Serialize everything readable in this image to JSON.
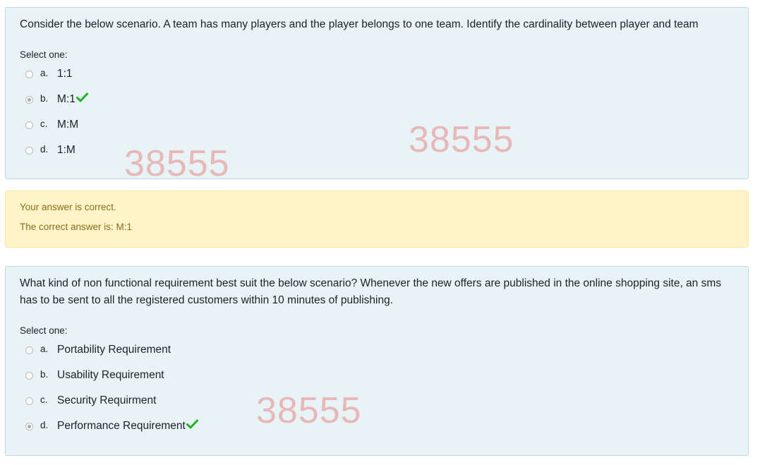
{
  "questions": [
    {
      "text": "Consider the below scenario. A team has many players and the player belongs to one team. Identify the  cardinality between player and team",
      "prompt": "Select one:",
      "options": [
        {
          "letter": "a.",
          "text": "1:1",
          "selected": false
        },
        {
          "letter": "b.",
          "text": "M:1",
          "selected": true,
          "correct": true
        },
        {
          "letter": "c.",
          "text": "M:M",
          "selected": false
        },
        {
          "letter": "d.",
          "text": "1:M",
          "selected": false
        }
      ]
    },
    {
      "text": "What kind of non functional requirement best suit the below scenario?  Whenever the new offers are published in the online shopping site, an sms has to be sent to all the registered customers within 10 minutes of publishing.",
      "prompt": "Select one:",
      "options": [
        {
          "letter": "a.",
          "text": "Portability Requirement",
          "selected": false
        },
        {
          "letter": "b.",
          "text": "Usability Requirement",
          "selected": false
        },
        {
          "letter": "c.",
          "text": "Security Requirment",
          "selected": false
        },
        {
          "letter": "d.",
          "text": "Performance Requirement",
          "selected": true,
          "correct": true
        }
      ]
    }
  ],
  "feedback": {
    "result": "Your answer is correct.",
    "correct_answer": "The correct answer is: M:1"
  },
  "watermarks": [
    "38555",
    "38555",
    "38555"
  ],
  "colors": {
    "question_bg": "#e7f3f5",
    "feedback_bg": "#fff3c8",
    "check_green": "#1fb11f",
    "watermark": "#e8b7b8"
  }
}
